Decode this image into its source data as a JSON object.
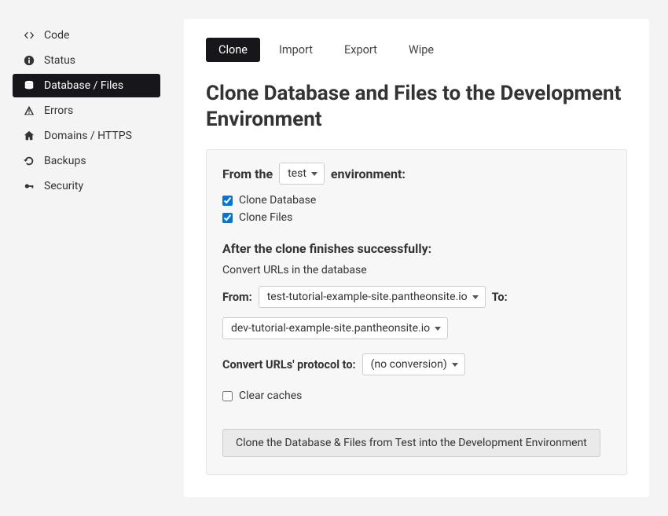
{
  "sidebar": {
    "items": [
      {
        "label": "Code"
      },
      {
        "label": "Status"
      },
      {
        "label": "Database / Files"
      },
      {
        "label": "Errors"
      },
      {
        "label": "Domains / HTTPS"
      },
      {
        "label": "Backups"
      },
      {
        "label": "Security"
      }
    ]
  },
  "tabs": [
    {
      "label": "Clone"
    },
    {
      "label": "Import"
    },
    {
      "label": "Export"
    },
    {
      "label": "Wipe"
    }
  ],
  "page": {
    "title": "Clone Database and Files to the Development Environment"
  },
  "panel": {
    "from_prefix": "From the",
    "env_select": "test",
    "from_suffix": "environment:",
    "clone_db_label": "Clone Database",
    "clone_files_label": "Clone Files",
    "after_header": "After the clone finishes successfully:",
    "convert_urls_text": "Convert URLs in the database",
    "from_label": "From:",
    "from_url": "test-tutorial-example-site.pantheonsite.io",
    "to_label": "To:",
    "to_url": "dev-tutorial-example-site.pantheonsite.io",
    "protocol_label": "Convert URLs' protocol to:",
    "protocol_value": "(no conversion)",
    "clear_caches_label": "Clear caches",
    "submit_label": "Clone the Database & Files from Test into the Development Environment"
  },
  "checkboxes": {
    "clone_db": true,
    "clone_files": true,
    "clear_caches": false
  }
}
